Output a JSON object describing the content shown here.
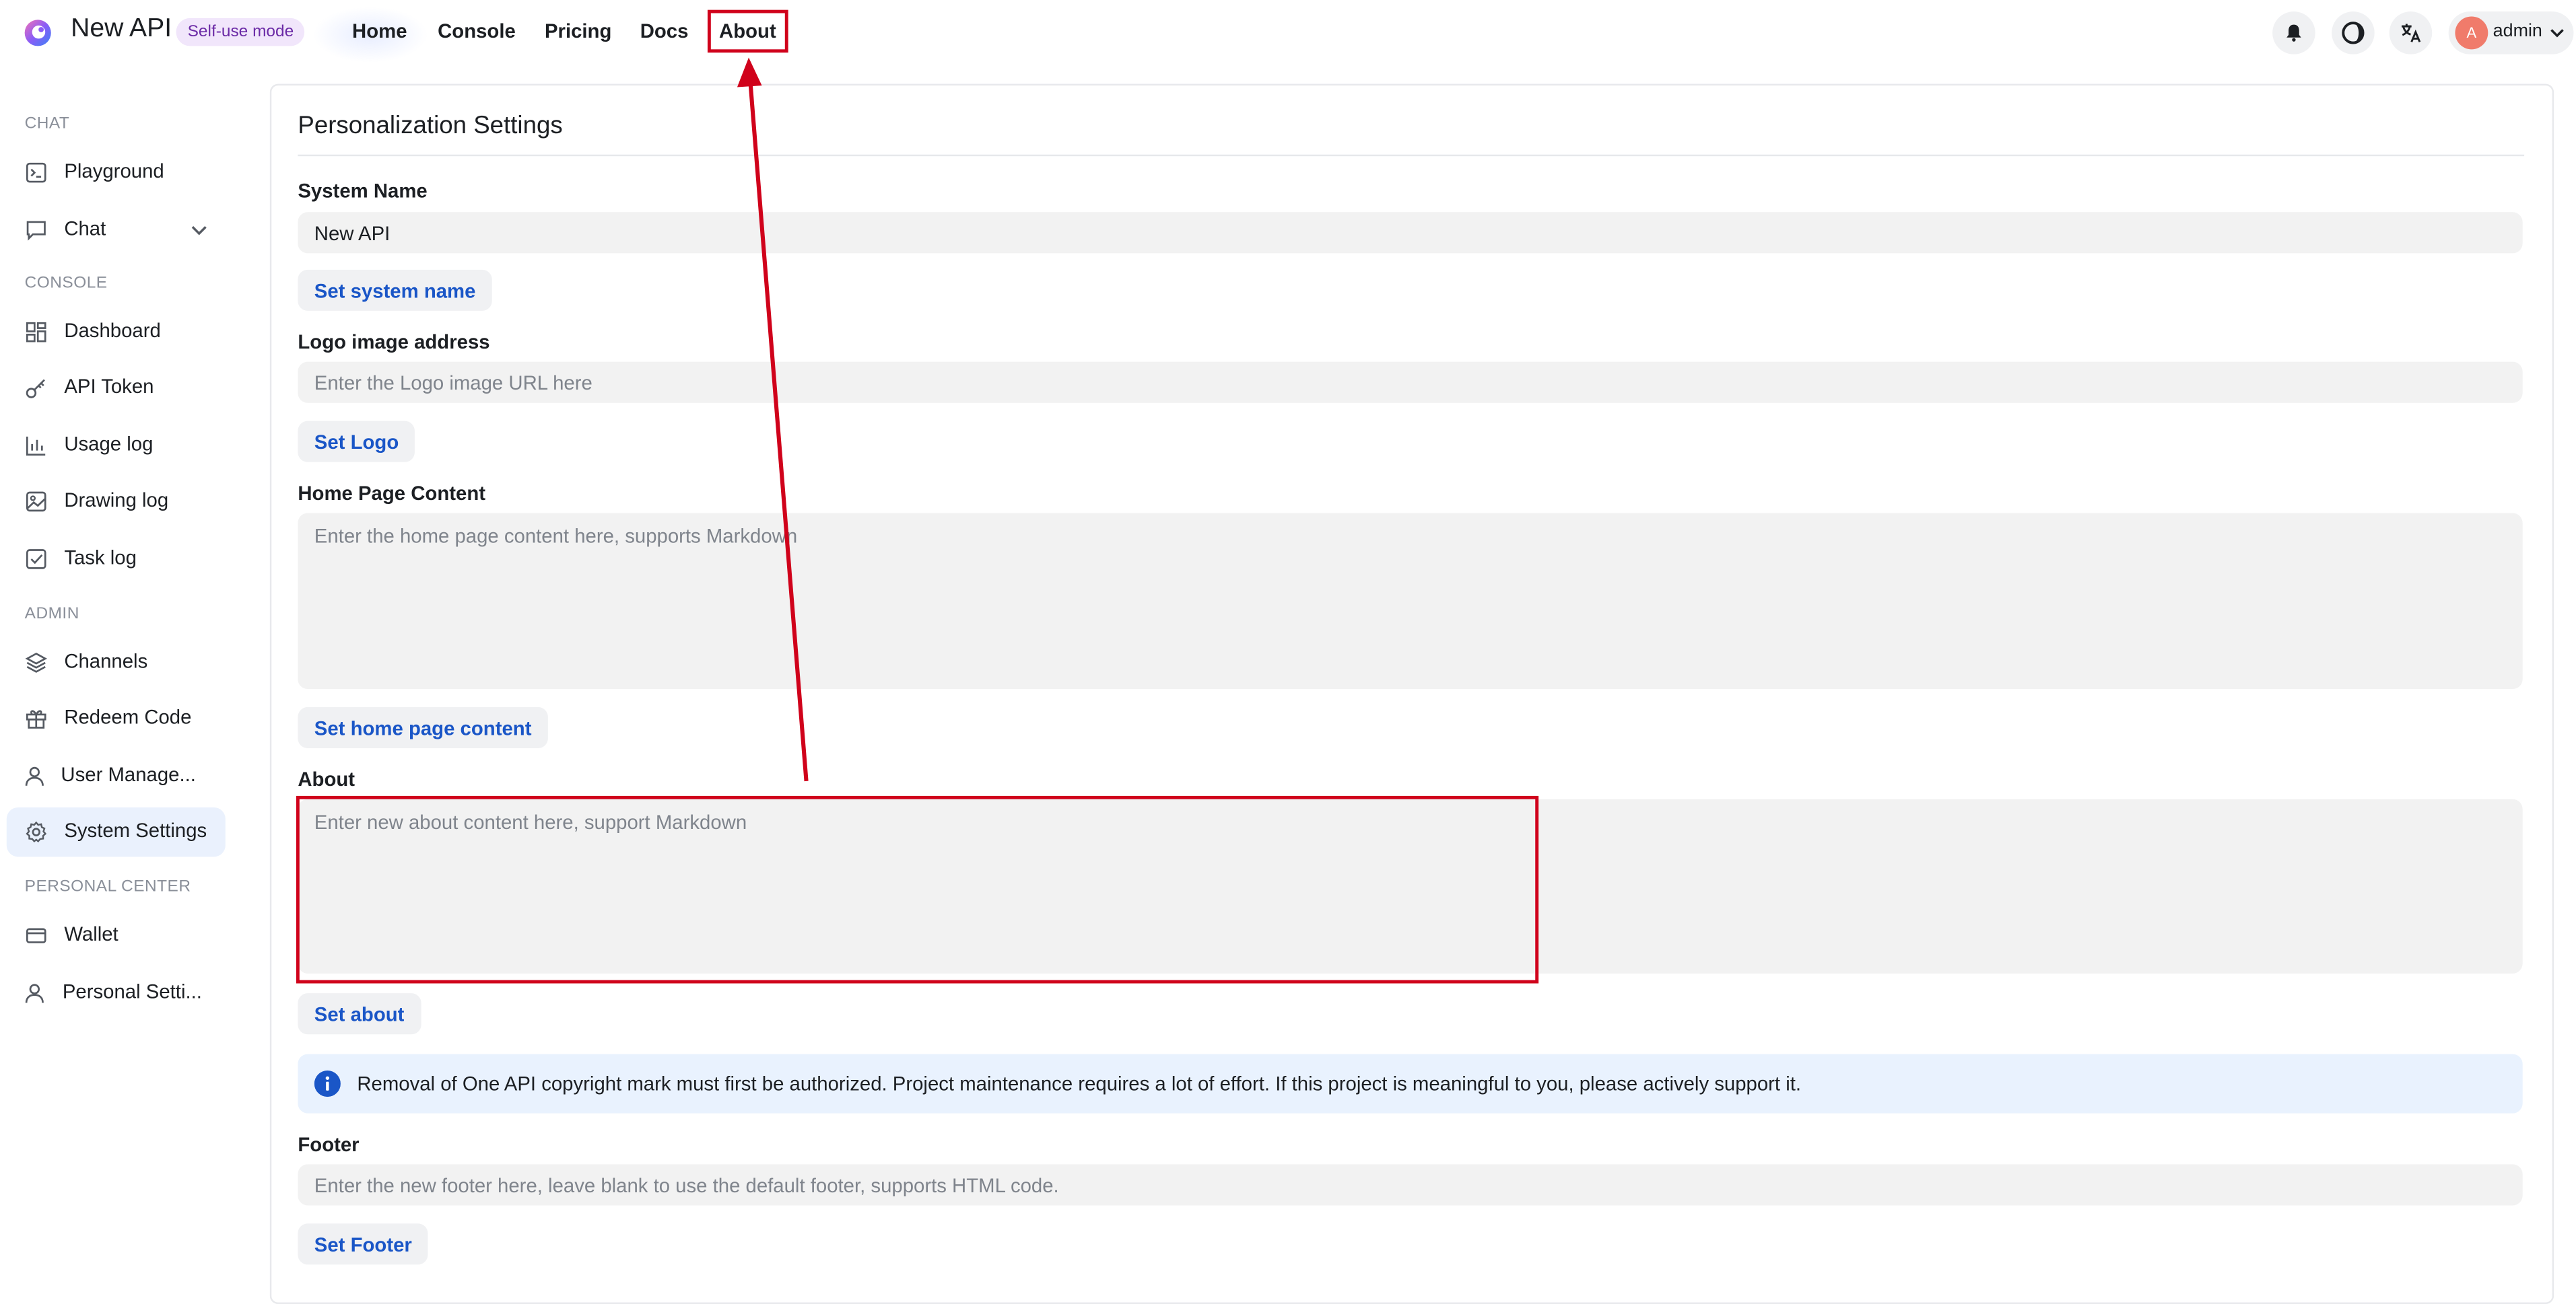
{
  "header": {
    "brand": "New API",
    "mode_badge": "Self-use mode",
    "nav": [
      "Home",
      "Console",
      "Pricing",
      "Docs",
      "About"
    ],
    "user": {
      "avatar_initial": "A",
      "name": "admin"
    },
    "icons": [
      "bell-icon",
      "moon-icon",
      "translate-icon",
      "chevron-down-icon"
    ]
  },
  "sidebar": {
    "sections": [
      {
        "label": "CHAT",
        "items": [
          {
            "label": "Playground",
            "icon": "playground-icon"
          },
          {
            "label": "Chat",
            "icon": "chat-icon",
            "expandable": true
          }
        ]
      },
      {
        "label": "CONSOLE",
        "items": [
          {
            "label": "Dashboard",
            "icon": "dashboard-icon"
          },
          {
            "label": "API Token",
            "icon": "key-icon"
          },
          {
            "label": "Usage log",
            "icon": "chart-icon"
          },
          {
            "label": "Drawing log",
            "icon": "image-icon"
          },
          {
            "label": "Task log",
            "icon": "checkbox-icon"
          }
        ]
      },
      {
        "label": "ADMIN",
        "items": [
          {
            "label": "Channels",
            "icon": "layers-icon"
          },
          {
            "label": "Redeem Code",
            "icon": "gift-icon"
          },
          {
            "label": "User Manage...",
            "icon": "user-icon"
          },
          {
            "label": "System Settings",
            "icon": "gear-icon",
            "active": true
          }
        ]
      },
      {
        "label": "PERSONAL CENTER",
        "items": [
          {
            "label": "Wallet",
            "icon": "wallet-icon"
          },
          {
            "label": "Personal Setti...",
            "icon": "user-icon"
          }
        ]
      }
    ]
  },
  "main": {
    "title": "Personalization Settings",
    "system_name": {
      "label": "System Name",
      "value": "New API",
      "button": "Set system name"
    },
    "logo": {
      "label": "Logo image address",
      "placeholder": "Enter the Logo image URL here",
      "button": "Set Logo"
    },
    "home_content": {
      "label": "Home Page Content",
      "placeholder": "Enter the home page content here, supports Markdown",
      "button": "Set home page content"
    },
    "about": {
      "label": "About",
      "placeholder": "Enter new about content here, support Markdown",
      "button": "Set about"
    },
    "notice": "Removal of One API copyright mark must first be authorized. Project maintenance requires a lot of effort. If this project is meaningful to you, please actively support it.",
    "footer": {
      "label": "Footer",
      "placeholder": "Enter the new footer here, leave blank to use the default footer, supports HTML code.",
      "button": "Set Footer"
    }
  },
  "colors": {
    "accent": "#1a56c7",
    "badge_bg": "#f1e6fb",
    "badge_text": "#6b2aa6",
    "annotation_red": "#d0021b",
    "notice_bg": "#e9f2fe",
    "info_icon": "#1a56c7"
  }
}
